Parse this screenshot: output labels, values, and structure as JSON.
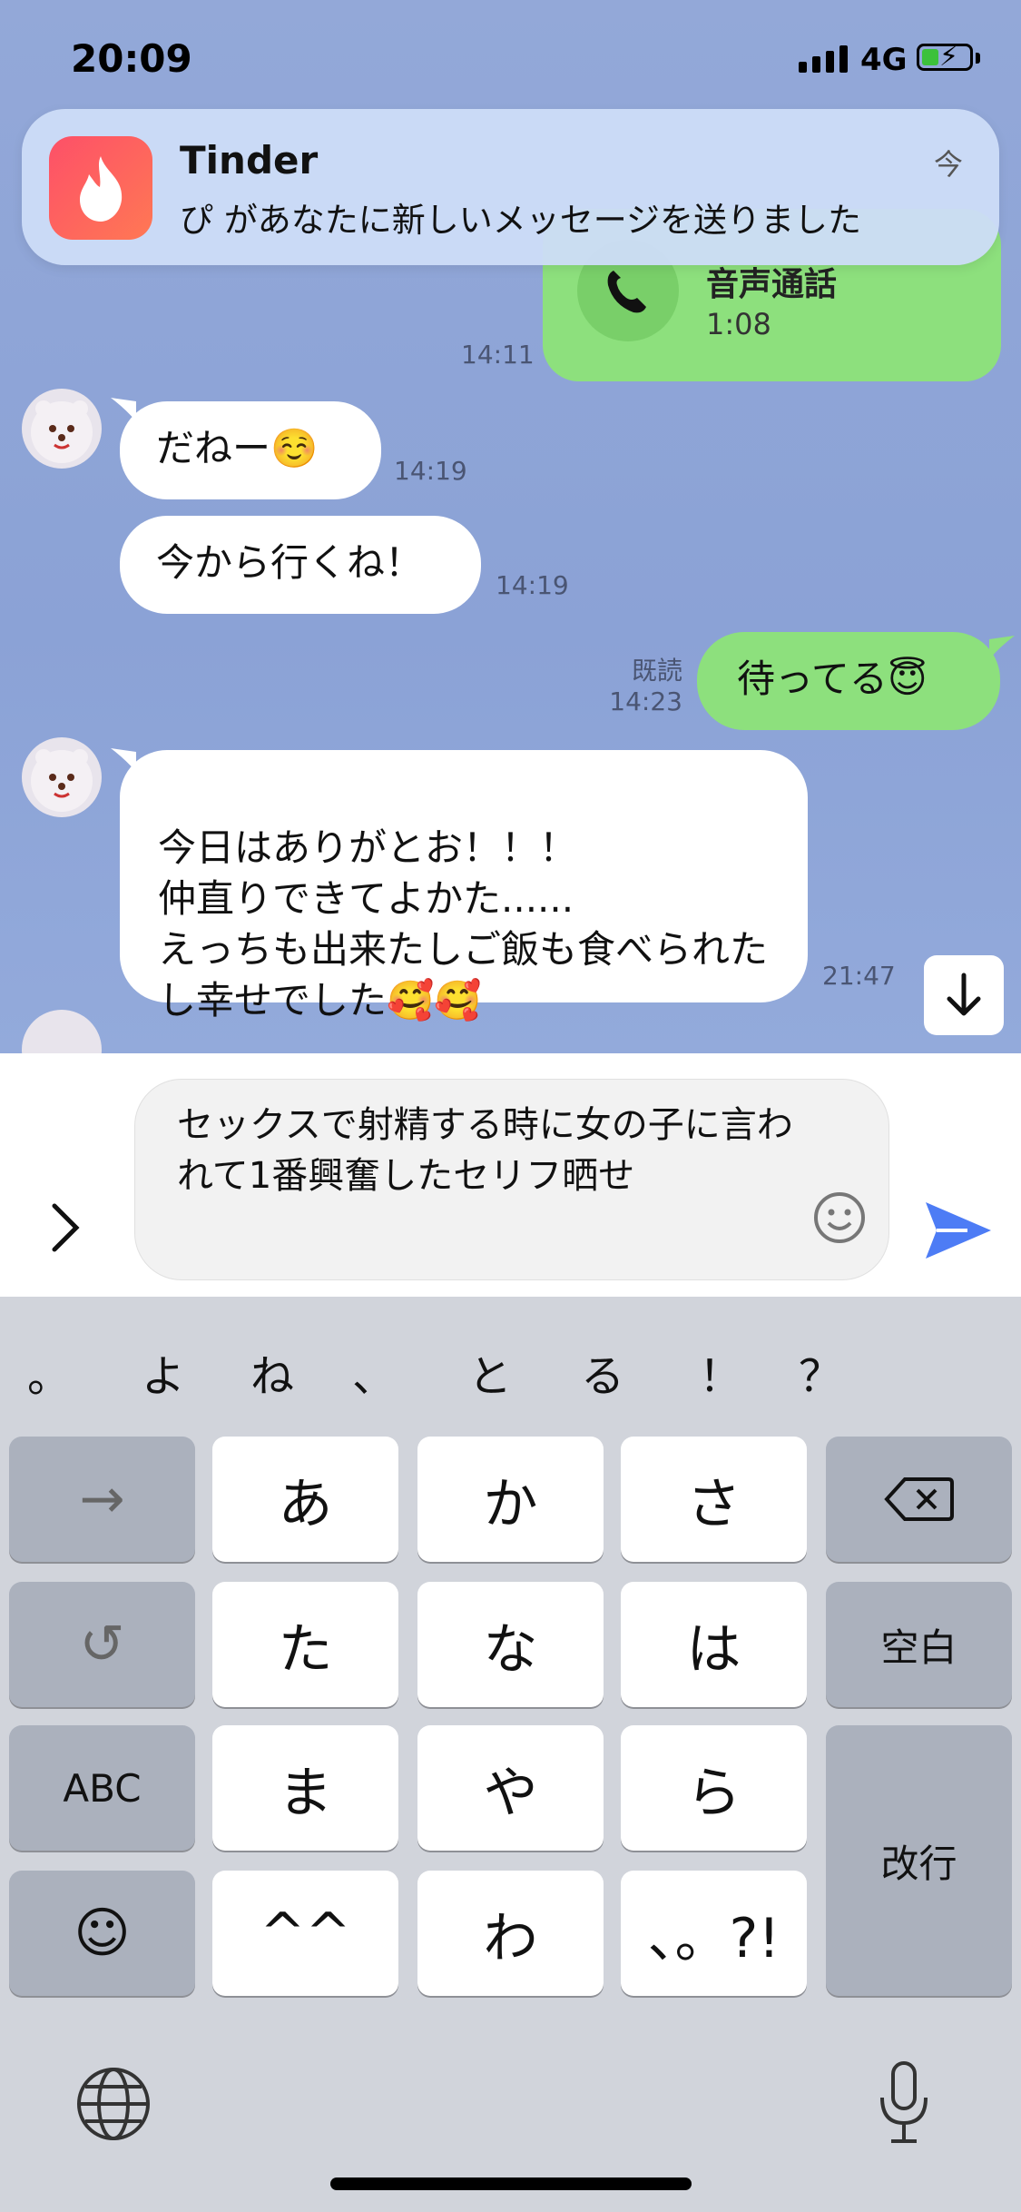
{
  "status": {
    "time": "20:09",
    "network": "4G"
  },
  "notification": {
    "app": "Tinder",
    "message": "ぴ があなたに新しいメッセージを送りました",
    "time": "今"
  },
  "call": {
    "title": "音声通話",
    "duration": "1:08",
    "time": "14:11"
  },
  "messages": [
    {
      "text": "だねー☺️",
      "time": "14:19",
      "side": "left"
    },
    {
      "text": "今から行くね！",
      "time": "14:19",
      "side": "left"
    },
    {
      "text": "待ってる😇",
      "time": "14:23",
      "read": "既読",
      "side": "right"
    },
    {
      "text": "今日はありがとお！！！\n仲直りできてよかた......\nえっちも出来たしご飯も食べられたし幸せでした🥰🥰",
      "time": "21:47",
      "side": "left"
    }
  ],
  "composer": {
    "text": "セックスで射精する時に女の子に言われて1番興奮したセリフ晒せ"
  },
  "keyboard": {
    "candidates": [
      "。",
      "よ",
      "ね",
      "、",
      "と",
      "る",
      "！",
      "？"
    ],
    "rows": [
      [
        "→",
        "あ",
        "か",
        "さ",
        "⌫"
      ],
      [
        "↺",
        "た",
        "な",
        "は",
        "空白"
      ],
      [
        "ABC",
        "ま",
        "や",
        "ら",
        "改行"
      ],
      [
        "☺",
        "^^",
        "わ",
        "、。?!"
      ]
    ]
  }
}
